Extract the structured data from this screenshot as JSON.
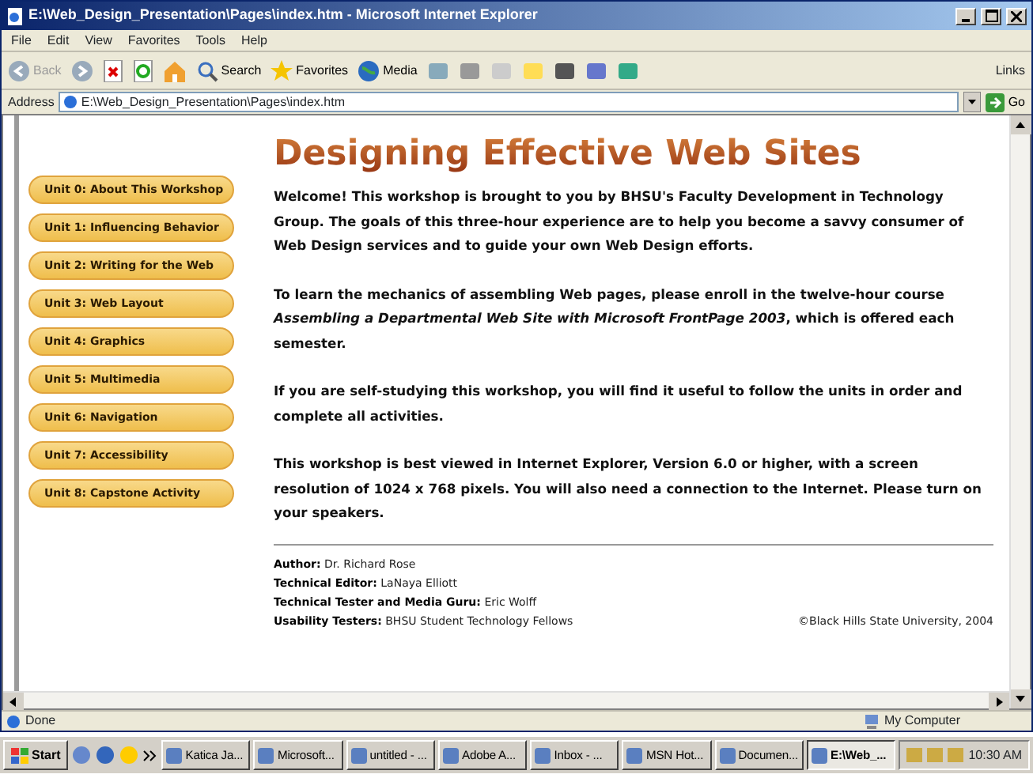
{
  "window": {
    "title": "E:\\Web_Design_Presentation\\Pages\\index.htm - Microsoft Internet Explorer"
  },
  "menu": [
    "File",
    "Edit",
    "View",
    "Favorites",
    "Tools",
    "Help"
  ],
  "toolbar": [
    {
      "label": "Back",
      "disabled": true
    },
    {
      "label": "Search",
      "disabled": false
    },
    {
      "label": "Favorites",
      "disabled": false
    },
    {
      "label": "Media",
      "disabled": false
    }
  ],
  "links": "Links",
  "address": {
    "label": "Address",
    "value": "E:\\Web_Design_Presentation\\Pages\\index.htm",
    "go": "Go"
  },
  "page": {
    "heading": "Designing Effective Web Sites",
    "nav": [
      {
        "label": "Unit 0: About This Workshop"
      },
      {
        "label": "Unit 1: Influencing Behavior"
      },
      {
        "label": "Unit 2: Writing for the Web"
      },
      {
        "label": "Unit 3: Web Layout"
      },
      {
        "label": "Unit 4: Graphics"
      },
      {
        "label": "Unit 5: Multimedia"
      },
      {
        "label": "Unit 6: Navigation"
      },
      {
        "label": "Unit 7: Accessibility"
      },
      {
        "label": "Unit 8: Capstone Activity"
      }
    ],
    "paragraphs": [
      "Welcome! This workshop is brought to you by BHSU's Faculty Development in Technology Group. The goals of this three-hour experience are to help you become a savvy consumer of Web Design services and to guide your own Web Design efforts.",
      "To learn the mechanics of assembling Web pages, please enroll in the twelve-hour course *Assembling a Departmental Web Site with Microsoft FrontPage 2003*, which is offered each semester.",
      "If you are self-studying this workshop, you will find it useful to follow the units in order and complete all activities.",
      "This workshop is best viewed in Internet Explorer, Version 6.0 or higher, with a screen resolution of 1024 x 768 pixels. You will also need a connection to the Internet. Please turn on your speakers."
    ],
    "credits": [
      {
        "role": "Author:",
        "name": "Dr. Richard Rose"
      },
      {
        "role": "Technical Editor:",
        "name": "LaNaya Elliott"
      },
      {
        "role": "Technical Tester and Media Guru:",
        "name": "Eric Wolff"
      },
      {
        "role": "Usability Testers:",
        "name": "BHSU Student Technology Fellows"
      }
    ],
    "copyright": "©Black Hills State University, 2004"
  },
  "status_bar": {
    "text": "Done",
    "zone": "My Computer"
  },
  "taskbar": {
    "start": "Start",
    "tasks": [
      {
        "label": "Katica Ja...",
        "selected": false
      },
      {
        "label": "Microsoft...",
        "selected": false
      },
      {
        "label": "untitled - ...",
        "selected": false
      },
      {
        "label": "Adobe A...",
        "selected": false
      },
      {
        "label": "Inbox - ...",
        "selected": false
      },
      {
        "label": "MSN Hot...",
        "selected": false
      },
      {
        "label": "Documen...",
        "selected": false
      },
      {
        "label": "E:\\Web_...",
        "selected": true
      }
    ],
    "clock": "10:30 AM"
  }
}
